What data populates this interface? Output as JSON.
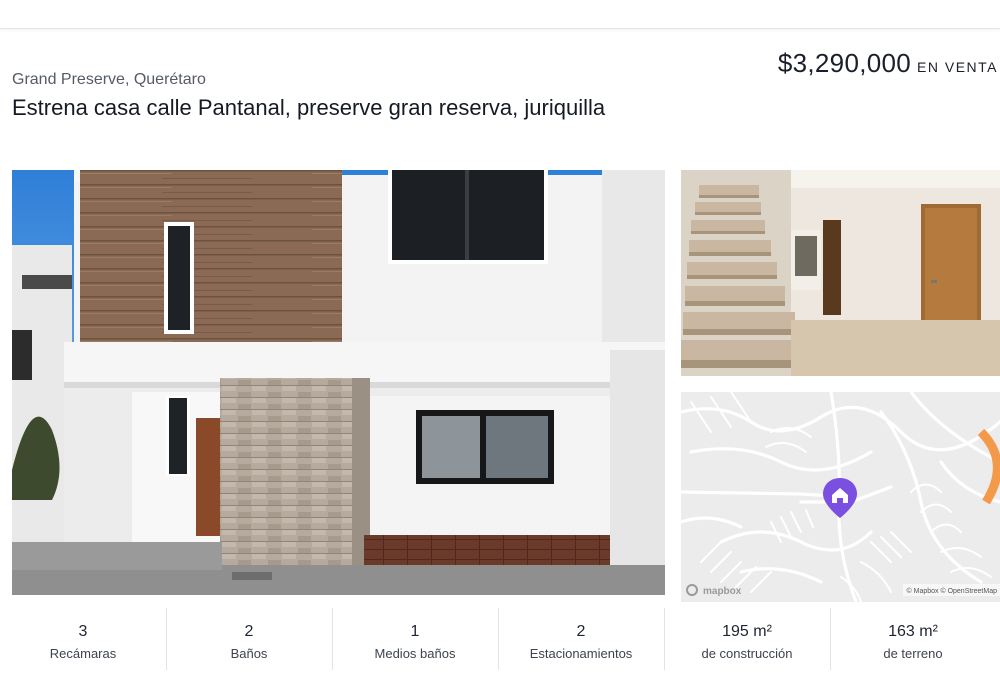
{
  "listing": {
    "location": "Grand Preserve, Querétaro",
    "title": "Estrena casa calle Pantanal, preserve gran reserva, juriquilla",
    "price": "$3,290,000",
    "operation": "EN VENTA"
  },
  "map": {
    "attribution": "© Mapbox © OpenStreetMap",
    "logo_text": "mapbox",
    "marker_icon": "home-icon",
    "accent_color": "#7b4fe0"
  },
  "stats": [
    {
      "value": "3",
      "label": "Recámaras"
    },
    {
      "value": "2",
      "label": "Baños"
    },
    {
      "value": "1",
      "label": "Medios baños"
    },
    {
      "value": "2",
      "label": "Estacionamientos"
    },
    {
      "value": "195 m²",
      "label": "de construcción"
    },
    {
      "value": "163 m²",
      "label": "de terreno"
    }
  ]
}
